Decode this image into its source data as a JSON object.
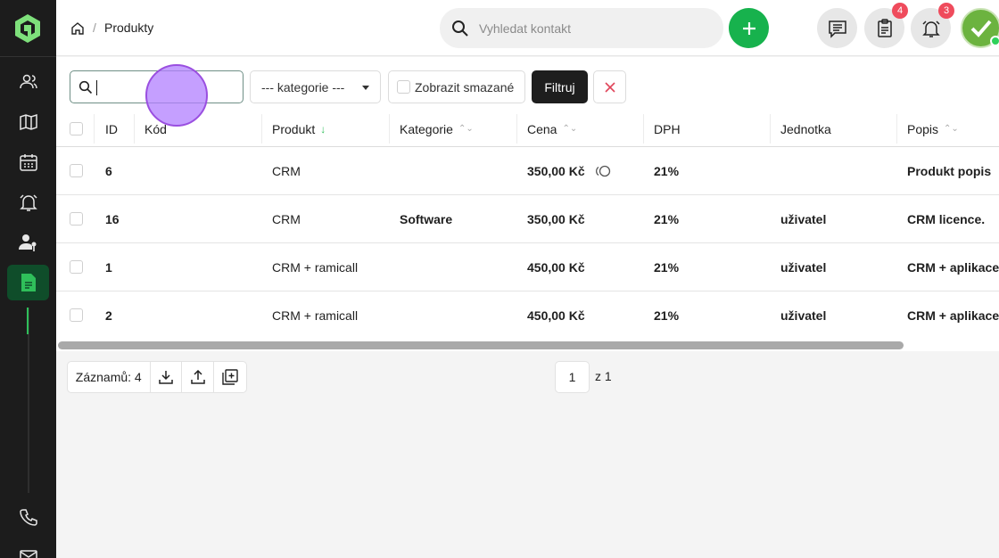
{
  "breadcrumb": {
    "current": "Produkty"
  },
  "search": {
    "placeholder": "Vyhledat kontakt"
  },
  "badges": {
    "tasks": "4",
    "notifications": "3"
  },
  "filters": {
    "category_select": "--- kategorie ---",
    "show_deleted_label": "Zobrazit smazané",
    "filter_button": "Filtruj"
  },
  "table": {
    "headers": {
      "id": "ID",
      "code": "Kód",
      "product": "Produkt",
      "category": "Kategorie",
      "price": "Cena",
      "vat": "DPH",
      "unit": "Jednotka",
      "description": "Popis"
    },
    "rows": [
      {
        "id": "6",
        "code": "",
        "product": "CRM",
        "category": "",
        "price": "350,00 Kč",
        "vat": "21%",
        "unit": "",
        "description": "Produkt popis"
      },
      {
        "id": "16",
        "code": "",
        "product": "CRM",
        "category": "Software",
        "price": "350,00 Kč",
        "vat": "21%",
        "unit": "uživatel",
        "description": "CRM licence."
      },
      {
        "id": "1",
        "code": "",
        "product": "CRM + ramicall",
        "category": "",
        "price": "450,00 Kč",
        "vat": "21%",
        "unit": "uživatel",
        "description": "CRM + aplikace"
      },
      {
        "id": "2",
        "code": "",
        "product": "CRM + ramicall",
        "category": "",
        "price": "450,00 Kč",
        "vat": "21%",
        "unit": "uživatel",
        "description": "CRM + aplikace"
      }
    ]
  },
  "footer": {
    "records": "Záznamů: 4",
    "page": "1",
    "total_pages": "z 1"
  },
  "colors": {
    "accent": "#17b24d",
    "badge": "#ef4b5c",
    "sidebar": "#1c1c1c"
  }
}
